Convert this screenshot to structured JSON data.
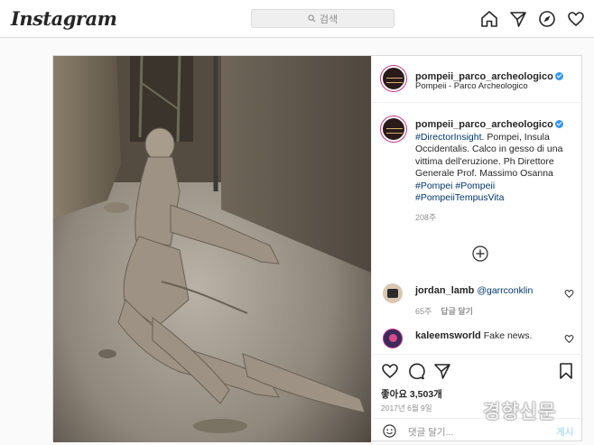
{
  "header": {
    "logo": "Instagram",
    "search_placeholder": "검색",
    "icons": [
      "home-icon",
      "direct-icon",
      "explore-icon",
      "activity-heart-icon"
    ]
  },
  "post": {
    "username": "pompeii_parco_archeologico",
    "location": "Pompeii - Parco Archeologico",
    "caption": {
      "hashtag_start": "#DirectorInsight",
      "text": ". Pompei, Insula Occidentalis. Calco in gesso di una vittima dell'eruzione. Ph Direttore Generale Prof. Massimo Osanna",
      "hashtags_line1_a": "#Pompei",
      "hashtags_line1_b": "#Pompeii",
      "hashtags_line2": "#PompeiiTempusVita",
      "age": "208주"
    },
    "comments": [
      {
        "user": "jordan_lamb",
        "mention": "@garrconklin",
        "text": "",
        "age": "65주",
        "reply": "답글 달기"
      },
      {
        "user": "kaleemsworld",
        "mention": "",
        "text": "Fake news.",
        "age": "",
        "reply": ""
      }
    ],
    "likes": "좋아요 3,503개",
    "date": "2017년 6월 9일",
    "add_comment_placeholder": "댓글 달기...",
    "post_button": "게시"
  },
  "watermark": "경향신문",
  "colors": {
    "verified": "#3897f0",
    "hashtag": "#00376b",
    "post_button": "#b2dffc"
  }
}
